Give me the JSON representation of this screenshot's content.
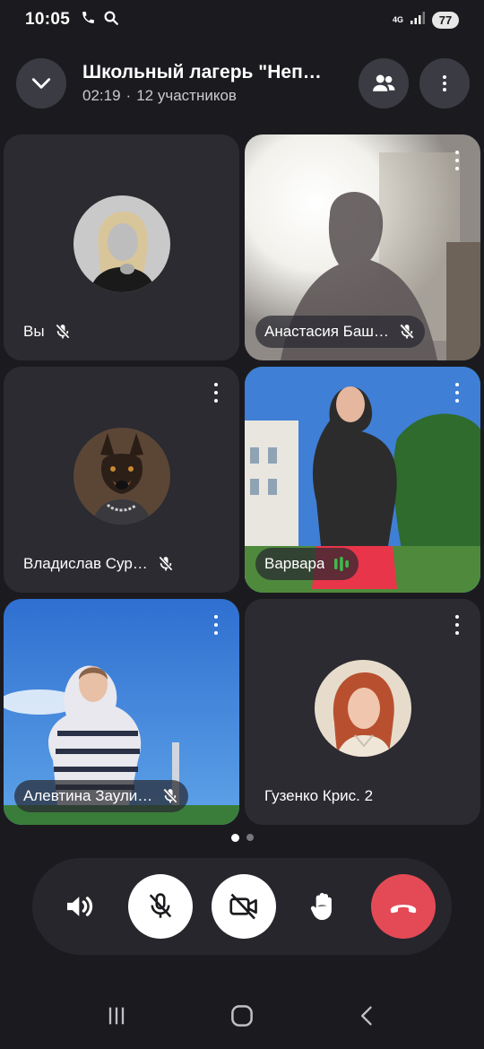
{
  "status_bar": {
    "time": "10:05",
    "network": "4G",
    "battery": "77"
  },
  "header": {
    "title": "Школьный лагерь \"Неп…",
    "duration": "02:19",
    "separator": "·",
    "participants": "12 участников"
  },
  "tiles": [
    {
      "name": "Вы",
      "muted": true,
      "type": "avatar"
    },
    {
      "name": "Анастасия Баш…",
      "muted": true,
      "type": "video"
    },
    {
      "name": "Владислав Сур…",
      "muted": true,
      "type": "avatar"
    },
    {
      "name": "Варвара",
      "muted": false,
      "speaking": true,
      "type": "video"
    },
    {
      "name": "Алевтина Заули…",
      "muted": true,
      "type": "video"
    },
    {
      "name": "Гузенко Крис. 2",
      "muted": false,
      "type": "avatar"
    }
  ],
  "pagination": {
    "pages": 2,
    "current": 1
  },
  "controls": [
    "speaker-icon",
    "mic-off-icon",
    "camera-off-icon",
    "raise-hand-icon",
    "end-call-icon"
  ],
  "colors": {
    "background": "#1b1b1f",
    "tile": "#2b2b31",
    "speaking": "#3dbb4b",
    "end_call": "#e44a55"
  }
}
